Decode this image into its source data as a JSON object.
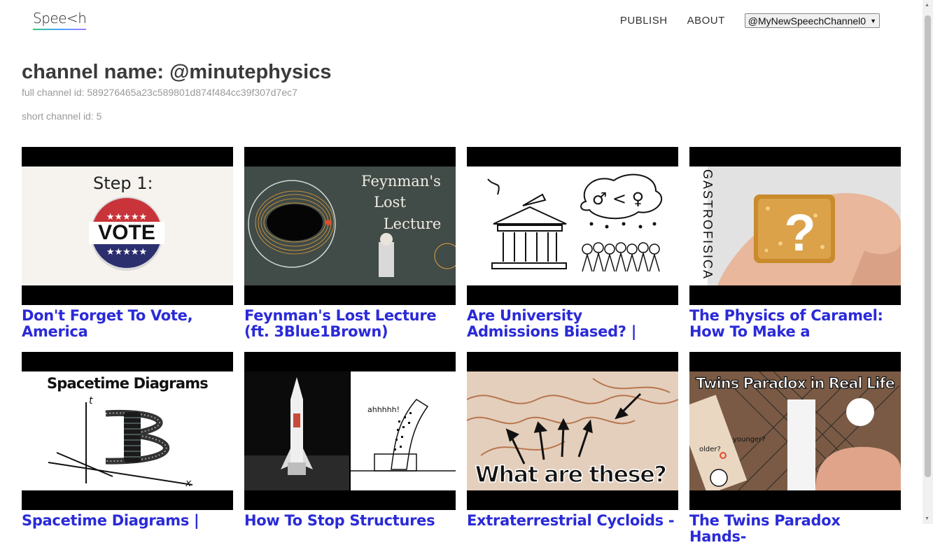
{
  "header": {
    "logo": "Spee<h",
    "nav": {
      "publish": "PUBLISH",
      "about": "ABOUT"
    },
    "channel_select": "@MyNewSpeechChannel0"
  },
  "channel": {
    "name": "channel name: @minutephysics",
    "full_id": "full channel id: 589276465a23c589801d874f484cc39f307d7ec7",
    "short_id": "short channel id: 5"
  },
  "videos": [
    {
      "title": "Don't Forget To Vote, America",
      "thumb_text": [
        "Step 1:",
        "VOTE"
      ]
    },
    {
      "title": "Feynman's Lost Lecture (ft. 3Blue1Brown)",
      "thumb_text": [
        "Feynman's",
        "Lost",
        "Lecture"
      ]
    },
    {
      "title": "Are University Admissions Biased? | Simpson's",
      "thumb_text": [
        "♂ < ♀"
      ]
    },
    {
      "title": "The Physics of Caramel: How To Make a",
      "thumb_text": [
        "GASTROFISICA",
        "?"
      ]
    },
    {
      "title": "Spacetime Diagrams |",
      "thumb_text": [
        "Spacetime Diagrams",
        "t",
        "x"
      ]
    },
    {
      "title": "How To Stop Structures",
      "thumb_text": [
        "ahhhhh!"
      ]
    },
    {
      "title": "Extraterrestrial Cycloids -",
      "thumb_text": [
        "What are these?"
      ]
    },
    {
      "title": "The Twins Paradox Hands-",
      "thumb_text": [
        "Twins Paradox in Real Life",
        "older?",
        "younger?"
      ]
    }
  ],
  "colors": {
    "link": "#2a2ad8",
    "title": "#3a3a3a",
    "meta": "#9a9a9a"
  }
}
